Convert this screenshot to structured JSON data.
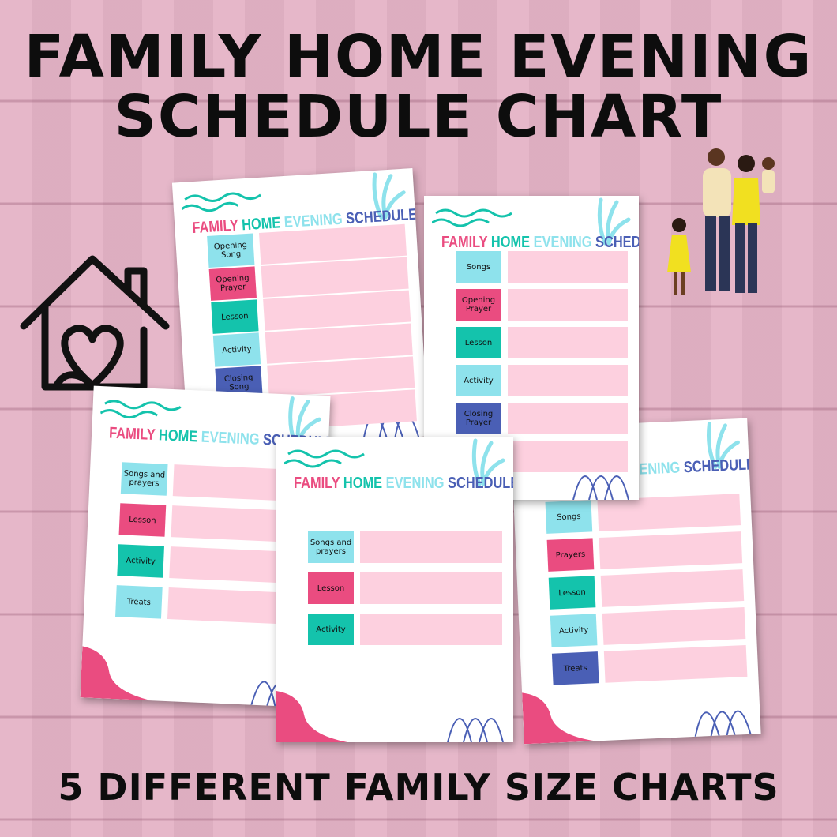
{
  "title_line1": "FAMILY HOME EVENING",
  "title_line2": "SCHEDULE CHART",
  "footer": "5 DIFFERENT FAMILY SIZE CHARTS",
  "colors": {
    "pink": "#ea4c80",
    "teal": "#14c3ac",
    "cyan": "#8ee2ec",
    "indigo": "#4a5fb5",
    "fill": "#fdd0df",
    "bg": "#e4b3c6"
  },
  "card_title": {
    "w1": "FAMILY",
    "w2": "HOME",
    "w3": "EVENING",
    "w4": "SCHEDULE"
  },
  "cards": [
    {
      "rows": [
        {
          "label": "Opening Song",
          "color": "cyan"
        },
        {
          "label": "Opening Prayer",
          "color": "pink"
        },
        {
          "label": "Lesson",
          "color": "teal"
        },
        {
          "label": "Activity",
          "color": "cyan"
        },
        {
          "label": "Closing Song",
          "color": "indigo"
        },
        {
          "label": "",
          "color": "none"
        }
      ]
    },
    {
      "rows": [
        {
          "label": "Songs",
          "color": "cyan"
        },
        {
          "label": "Prayers",
          "color": "pink"
        },
        {
          "label": "Lesson",
          "color": "teal"
        },
        {
          "label": "Activity",
          "color": "cyan"
        },
        {
          "label": "Treats",
          "color": "indigo"
        }
      ]
    },
    {
      "rows": [
        {
          "label": "Songs",
          "color": "cyan"
        },
        {
          "label": "Opening Prayer",
          "color": "pink"
        },
        {
          "label": "Lesson",
          "color": "teal"
        },
        {
          "label": "Activity",
          "color": "cyan"
        },
        {
          "label": "Closing Prayer",
          "color": "indigo"
        },
        {
          "label": "",
          "color": "none"
        }
      ]
    },
    {
      "rows": [
        {
          "label": "Songs and prayers",
          "color": "cyan"
        },
        {
          "label": "Lesson",
          "color": "pink"
        },
        {
          "label": "Activity",
          "color": "teal"
        },
        {
          "label": "Treats",
          "color": "cyan"
        }
      ]
    },
    {
      "rows": [
        {
          "label": "Songs and prayers",
          "color": "cyan"
        },
        {
          "label": "Lesson",
          "color": "pink"
        },
        {
          "label": "Activity",
          "color": "teal"
        }
      ]
    }
  ],
  "icons": [
    "house-heart-icon",
    "family-illustration"
  ]
}
